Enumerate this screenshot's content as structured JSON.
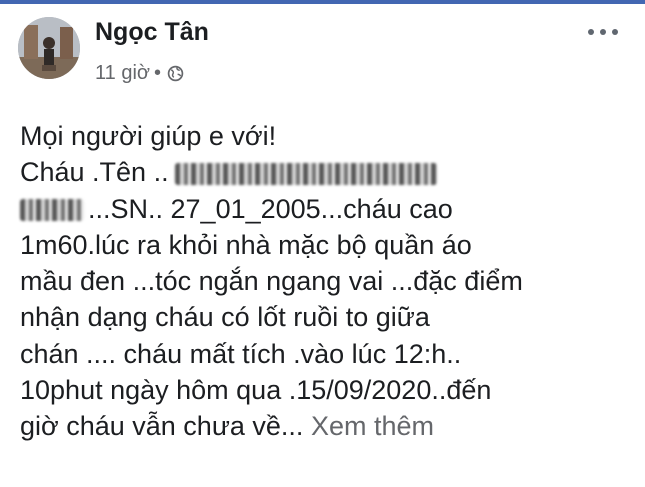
{
  "post": {
    "author": "Ngọc Tân",
    "timestamp": "11 giờ",
    "separator": "•",
    "privacy_icon": "globe-icon",
    "more_icon": "more-options-icon",
    "lines": [
      "Mọi người giúp e với!",
      "Cháu .Tên ..",
      "...SN.. 27_01_2005...cháu cao",
      "1m60.lúc ra khỏi nhà mặc bộ quần áo",
      "mầu đen ...tóc ngắn ngang vai ...đặc điểm",
      "nhận dạng cháu có lốt ruồi to giữa",
      "chán .... cháu mất tích  .vào lúc 12:h..",
      "10phut ngày hôm qua .15/09/2020..đến",
      "giờ cháu vẫn chưa về..."
    ],
    "see_more": "Xem thêm"
  },
  "colors": {
    "brand": "#4267b2",
    "text": "#1c1e21",
    "secondary": "#65676b"
  }
}
